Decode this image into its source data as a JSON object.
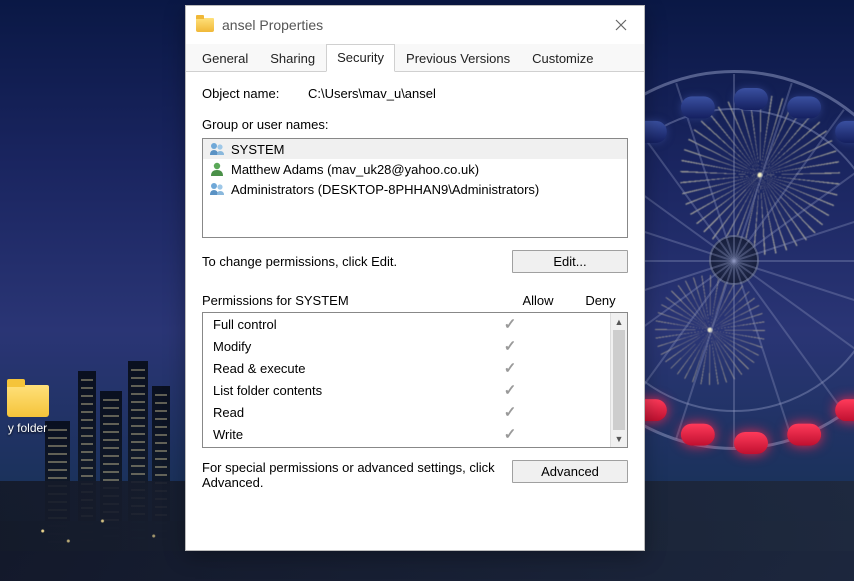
{
  "desktop": {
    "folder_label": "y folder"
  },
  "dialog": {
    "title": "ansel Properties",
    "tabs": {
      "general": "General",
      "sharing": "Sharing",
      "security": "Security",
      "previous": "Previous Versions",
      "customize": "Customize"
    },
    "object_name_label": "Object name:",
    "object_name_value": "C:\\Users\\mav_u\\ansel",
    "group_label": "Group or user names:",
    "users": [
      {
        "name": "SYSTEM",
        "icon": "group"
      },
      {
        "name": "Matthew Adams (mav_uk28@yahoo.co.uk)",
        "icon": "user"
      },
      {
        "name": "Administrators (DESKTOP-8PHHAN9\\Administrators)",
        "icon": "group"
      }
    ],
    "edit_hint": "To change permissions, click Edit.",
    "edit_button": "Edit...",
    "perm_header": "Permissions for SYSTEM",
    "allow_col": "Allow",
    "deny_col": "Deny",
    "permissions": [
      {
        "name": "Full control",
        "allow": true,
        "deny": false
      },
      {
        "name": "Modify",
        "allow": true,
        "deny": false
      },
      {
        "name": "Read & execute",
        "allow": true,
        "deny": false
      },
      {
        "name": "List folder contents",
        "allow": true,
        "deny": false
      },
      {
        "name": "Read",
        "allow": true,
        "deny": false
      },
      {
        "name": "Write",
        "allow": true,
        "deny": false
      }
    ],
    "advanced_hint": "For special permissions or advanced settings, click Advanced.",
    "advanced_button": "Advanced"
  }
}
